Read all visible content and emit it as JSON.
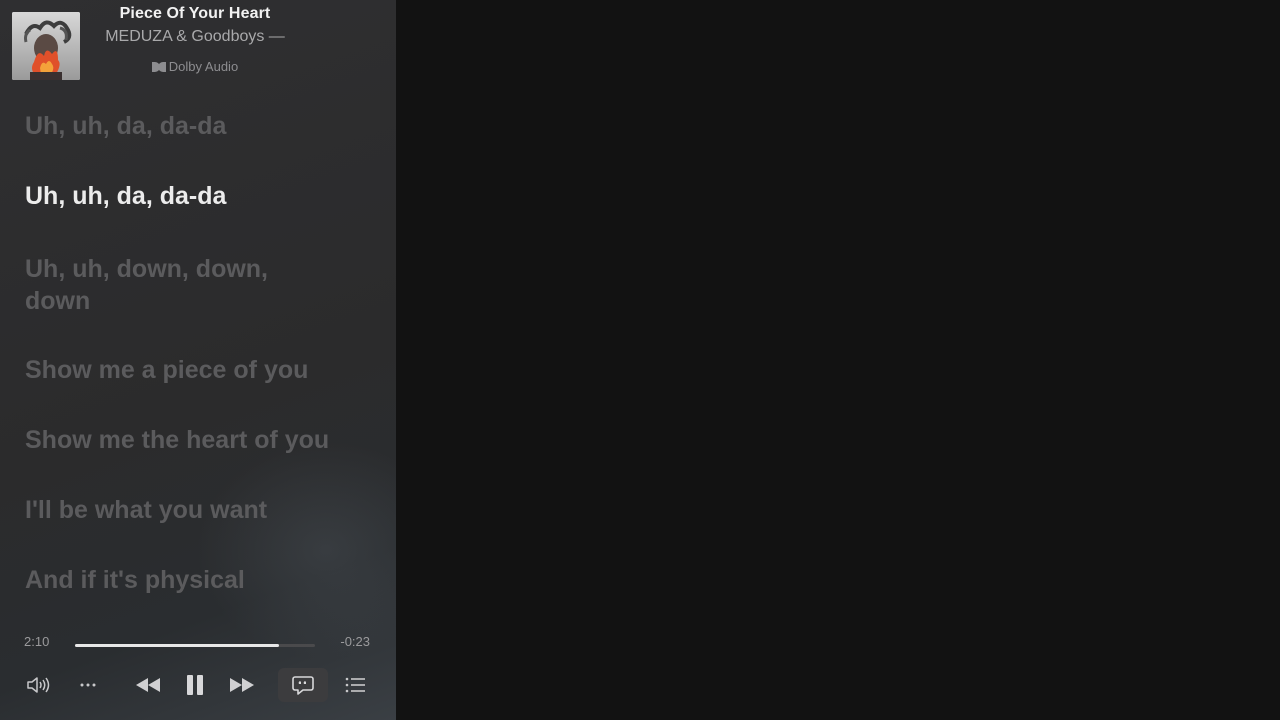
{
  "now_playing": {
    "title": "Piece Of Your Heart",
    "artist": "MEDUZA & Goodboys —",
    "audio_format": "Dolby Audio"
  },
  "lyrics": [
    {
      "text": "Uh, uh, da, da-da",
      "active": false
    },
    {
      "text": "Uh, uh, da, da-da",
      "active": true
    },
    {
      "text": "Uh, uh, down, down, down",
      "active": false
    },
    {
      "text": "Show me a piece of you",
      "active": false
    },
    {
      "text": "Show me the heart of you",
      "active": false
    },
    {
      "text": "I'll be what you want",
      "active": false
    },
    {
      "text": "And if it's physical",
      "active": false
    }
  ],
  "playback": {
    "elapsed": "2:10",
    "remaining": "-0:23",
    "progress": 0.85
  },
  "controls": {
    "volume_icon": "speaker-icon",
    "more_icon": "ellipsis-icon",
    "previous_icon": "rewind-icon",
    "pause_icon": "pause-icon",
    "next_icon": "fast-forward-icon",
    "lyrics_icon": "lyrics-bubble-icon",
    "queue_icon": "list-icon"
  },
  "colors": {
    "panel_bg": "#2f2f31",
    "window_bg": "#121212",
    "active_lyric": "#ececec",
    "inactive_lyric": "#5b5b5d"
  }
}
